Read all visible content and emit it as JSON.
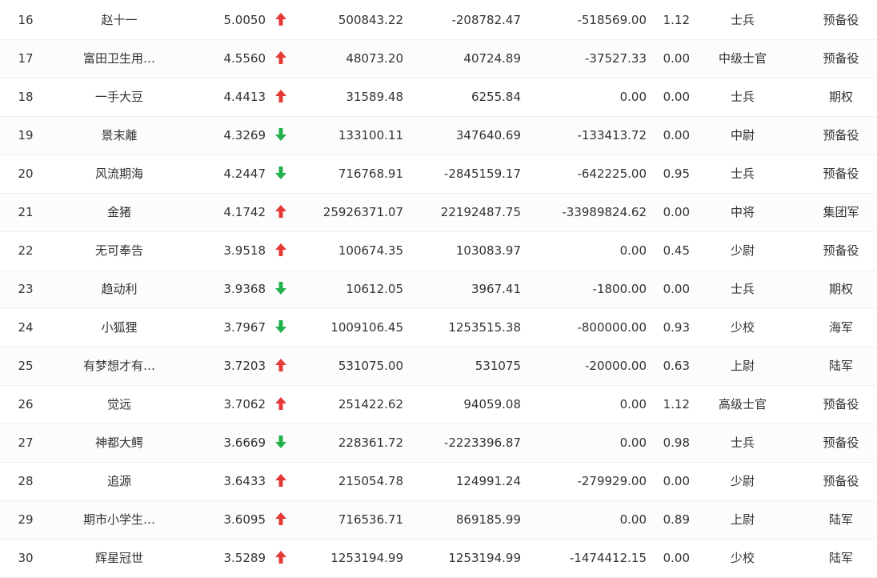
{
  "colors": {
    "up": "#e53935",
    "down": "#22b14c"
  },
  "rows": [
    {
      "rank": "16",
      "name": "赵十一",
      "score": "5.0050",
      "trend": "up",
      "v1": "500843.22",
      "v2": "-208782.47",
      "v3": "-518569.00",
      "ratio": "1.12",
      "title": "士兵",
      "category": "预备役"
    },
    {
      "rank": "17",
      "name": "富田卫生用…",
      "score": "4.5560",
      "trend": "up",
      "v1": "48073.20",
      "v2": "40724.89",
      "v3": "-37527.33",
      "ratio": "0.00",
      "title": "中级士官",
      "category": "预备役"
    },
    {
      "rank": "18",
      "name": "一手大豆",
      "score": "4.4413",
      "trend": "up",
      "v1": "31589.48",
      "v2": "6255.84",
      "v3": "0.00",
      "ratio": "0.00",
      "title": "士兵",
      "category": "期权"
    },
    {
      "rank": "19",
      "name": "景末離",
      "score": "4.3269",
      "trend": "down",
      "v1": "133100.11",
      "v2": "347640.69",
      "v3": "-133413.72",
      "ratio": "0.00",
      "title": "中尉",
      "category": "预备役"
    },
    {
      "rank": "20",
      "name": "风流期海",
      "score": "4.2447",
      "trend": "down",
      "v1": "716768.91",
      "v2": "-2845159.17",
      "v3": "-642225.00",
      "ratio": "0.95",
      "title": "士兵",
      "category": "预备役"
    },
    {
      "rank": "21",
      "name": "金猪",
      "score": "4.1742",
      "trend": "up",
      "v1": "25926371.07",
      "v2": "22192487.75",
      "v3": "-33989824.62",
      "ratio": "0.00",
      "title": "中将",
      "category": "集团军"
    },
    {
      "rank": "22",
      "name": "无可奉告",
      "score": "3.9518",
      "trend": "up",
      "v1": "100674.35",
      "v2": "103083.97",
      "v3": "0.00",
      "ratio": "0.45",
      "title": "少尉",
      "category": "预备役"
    },
    {
      "rank": "23",
      "name": "趋动利",
      "score": "3.9368",
      "trend": "down",
      "v1": "10612.05",
      "v2": "3967.41",
      "v3": "-1800.00",
      "ratio": "0.00",
      "title": "士兵",
      "category": "期权"
    },
    {
      "rank": "24",
      "name": "小狐狸",
      "score": "3.7967",
      "trend": "down",
      "v1": "1009106.45",
      "v2": "1253515.38",
      "v3": "-800000.00",
      "ratio": "0.93",
      "title": "少校",
      "category": "海军"
    },
    {
      "rank": "25",
      "name": "有梦想才有…",
      "score": "3.7203",
      "trend": "up",
      "v1": "531075.00",
      "v2": "531075",
      "v3": "-20000.00",
      "ratio": "0.63",
      "title": "上尉",
      "category": "陆军"
    },
    {
      "rank": "26",
      "name": "觉远",
      "score": "3.7062",
      "trend": "up",
      "v1": "251422.62",
      "v2": "94059.08",
      "v3": "0.00",
      "ratio": "1.12",
      "title": "高级士官",
      "category": "预备役"
    },
    {
      "rank": "27",
      "name": "神都大鳄",
      "score": "3.6669",
      "trend": "down",
      "v1": "228361.72",
      "v2": "-2223396.87",
      "v3": "0.00",
      "ratio": "0.98",
      "title": "士兵",
      "category": "预备役"
    },
    {
      "rank": "28",
      "name": "追源",
      "score": "3.6433",
      "trend": "up",
      "v1": "215054.78",
      "v2": "124991.24",
      "v3": "-279929.00",
      "ratio": "0.00",
      "title": "少尉",
      "category": "预备役"
    },
    {
      "rank": "29",
      "name": "期市小学生…",
      "score": "3.6095",
      "trend": "up",
      "v1": "716536.71",
      "v2": "869185.99",
      "v3": "0.00",
      "ratio": "0.89",
      "title": "上尉",
      "category": "陆军"
    },
    {
      "rank": "30",
      "name": "辉星冠世",
      "score": "3.5289",
      "trend": "up",
      "v1": "1253194.99",
      "v2": "1253194.99",
      "v3": "-1474412.15",
      "ratio": "0.00",
      "title": "少校",
      "category": "陆军"
    }
  ]
}
